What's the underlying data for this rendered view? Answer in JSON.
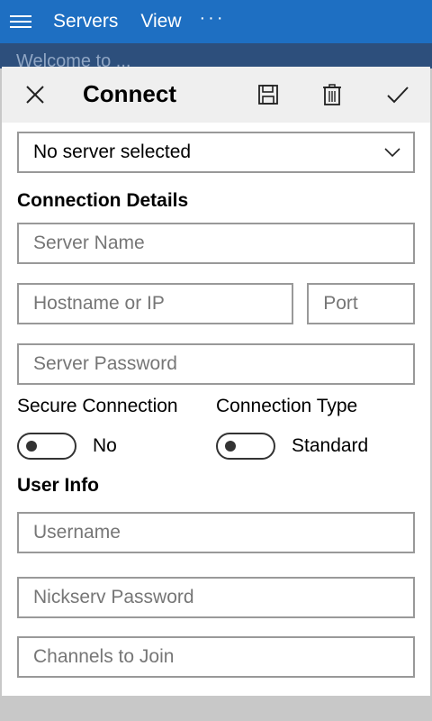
{
  "appbar": {
    "menu_items": [
      "Servers",
      "View"
    ],
    "more": "···"
  },
  "background": {
    "text": "Welcome to ..."
  },
  "panel": {
    "title": "Connect",
    "server_select": {
      "value": "No server selected"
    },
    "connection_section": "Connection Details",
    "fields": {
      "server_name": "Server Name",
      "hostname": "Hostname or IP",
      "port": "Port",
      "server_password": "Server Password",
      "username": "Username",
      "nickserv_password": "Nickserv Password",
      "channels": "Channels to Join"
    },
    "secure": {
      "label": "Secure Connection",
      "value": "No",
      "on": false
    },
    "conn_type": {
      "label": "Connection Type",
      "value": "Standard",
      "on": false
    },
    "user_section": "User Info"
  },
  "colors": {
    "accent": "#1e6fc2",
    "header_bg": "#efefef",
    "border": "#999999"
  },
  "icons": [
    "menu-icon",
    "close-icon",
    "save-icon",
    "delete-icon",
    "checkmark-icon",
    "chevron-down-icon"
  ]
}
